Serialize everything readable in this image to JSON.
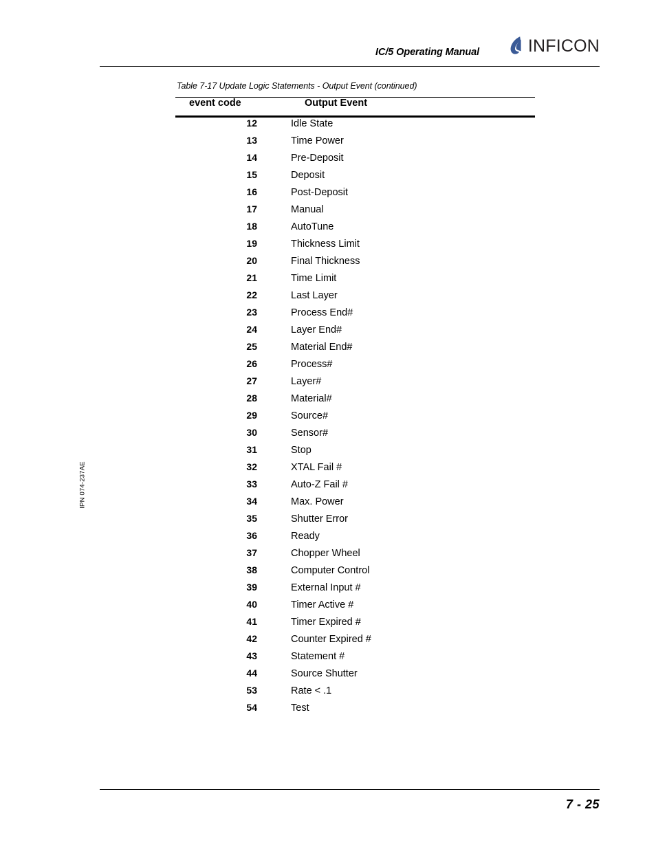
{
  "header": {
    "manual_title": "IC/5 Operating Manual",
    "logo_wordmark": "INFICON",
    "logo_mark_icon": "inficon-droplet-icon",
    "logo_color": "#3a5a96"
  },
  "side_note": {
    "part_number": "IPN 074-237AE"
  },
  "table": {
    "caption": "Table 7-17  Update Logic Statements - Output Event (continued)",
    "columns": [
      "event code",
      "Output Event"
    ],
    "rows": [
      {
        "code": "12",
        "event": "Idle State"
      },
      {
        "code": "13",
        "event": "Time Power"
      },
      {
        "code": "14",
        "event": "Pre-Deposit"
      },
      {
        "code": "15",
        "event": "Deposit"
      },
      {
        "code": "16",
        "event": "Post-Deposit"
      },
      {
        "code": "17",
        "event": "Manual"
      },
      {
        "code": "18",
        "event": "AutoTune"
      },
      {
        "code": "19",
        "event": "Thickness Limit"
      },
      {
        "code": "20",
        "event": "Final Thickness"
      },
      {
        "code": "21",
        "event": "Time Limit"
      },
      {
        "code": "22",
        "event": "Last Layer"
      },
      {
        "code": "23",
        "event": "Process End#"
      },
      {
        "code": "24",
        "event": "Layer End#"
      },
      {
        "code": "25",
        "event": "Material End#"
      },
      {
        "code": "26",
        "event": "Process#"
      },
      {
        "code": "27",
        "event": "Layer#"
      },
      {
        "code": "28",
        "event": "Material#"
      },
      {
        "code": "29",
        "event": "Source#"
      },
      {
        "code": "30",
        "event": "Sensor#"
      },
      {
        "code": "31",
        "event": "Stop"
      },
      {
        "code": "32",
        "event": "XTAL Fail #"
      },
      {
        "code": "33",
        "event": "Auto-Z Fail #"
      },
      {
        "code": "34",
        "event": "Max. Power"
      },
      {
        "code": "35",
        "event": "Shutter Error"
      },
      {
        "code": "36",
        "event": "Ready"
      },
      {
        "code": "37",
        "event": "Chopper Wheel"
      },
      {
        "code": "38",
        "event": "Computer Control"
      },
      {
        "code": "39",
        "event": "External Input #"
      },
      {
        "code": "40",
        "event": "Timer Active #"
      },
      {
        "code": "41",
        "event": "Timer Expired #"
      },
      {
        "code": "42",
        "event": "Counter Expired #"
      },
      {
        "code": "43",
        "event": "Statement #"
      },
      {
        "code": "44",
        "event": "Source Shutter"
      },
      {
        "code": "53",
        "event": "Rate < .1"
      },
      {
        "code": "54",
        "event": "Test"
      }
    ]
  },
  "footer": {
    "page_number": "7 - 25"
  }
}
